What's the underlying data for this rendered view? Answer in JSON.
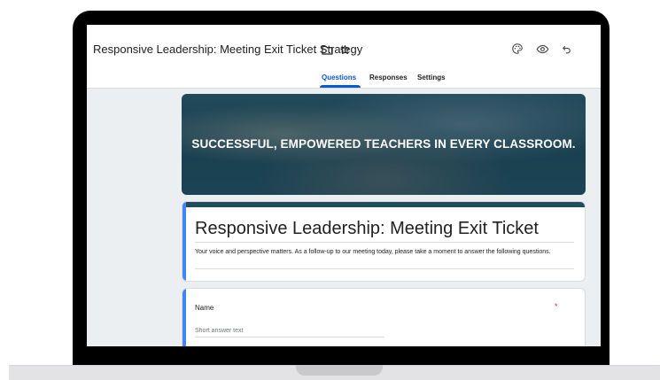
{
  "header": {
    "doc_title": "Responsive Leadership: Meeting Exit Ticket Strategy",
    "icons": [
      "folder-icon",
      "star-icon",
      "palette-icon",
      "eye-icon",
      "undo-icon"
    ]
  },
  "tabs": [
    {
      "label": "Questions",
      "active": true
    },
    {
      "label": "Responses",
      "active": false
    },
    {
      "label": "Settings",
      "active": false
    }
  ],
  "banner": {
    "text": "SUCCESSFUL, EMPOWERED TEACHERS IN EVERY CLASSROOM."
  },
  "form": {
    "title": "Responsive Leadership:  Meeting Exit Ticket",
    "description": "Your voice and perspective matters.  As a follow-up to our meeting today, please take a moment to answer the following questions."
  },
  "question": {
    "label": "Name",
    "required_mark": "*",
    "placeholder": "Short answer text"
  },
  "colors": {
    "accent": "#0b57d0",
    "theme": "#1e4d5c",
    "focus_bar": "#4285f4",
    "background": "#ebeff1",
    "required": "#d93025"
  }
}
